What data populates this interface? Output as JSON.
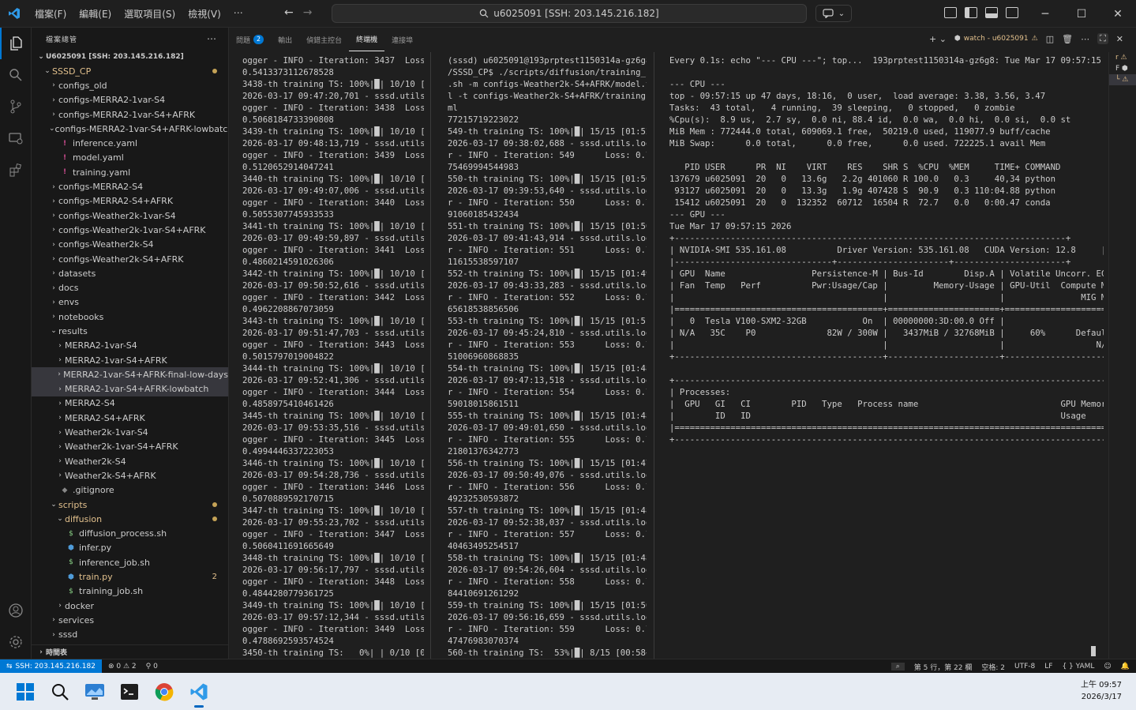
{
  "titlebar": {
    "menu": [
      "檔案(F)",
      "編輯(E)",
      "選取項目(S)",
      "檢視(V)",
      "⋯"
    ],
    "search": "u6025091 [SSH: 203.145.216.182]"
  },
  "sidebar": {
    "title": "檔案總管",
    "more": "⋯",
    "root": "U6025091 [SSH: 203.145.216.182]",
    "items": [
      {
        "label": "SSSD_CP",
        "indent": 1,
        "type": "folder-open",
        "mod": true,
        "dot": true
      },
      {
        "label": "configs_old",
        "indent": 2,
        "type": "folder"
      },
      {
        "label": "configs-MERRA2-1var-S4",
        "indent": 2,
        "type": "folder"
      },
      {
        "label": "configs-MERRA2-1var-S4+AFRK",
        "indent": 2,
        "type": "folder"
      },
      {
        "label": "configs-MERRA2-1var-S4+AFRK-lowbatch",
        "indent": 2,
        "type": "folder-open"
      },
      {
        "label": "inference.yaml",
        "indent": 3,
        "type": "yaml"
      },
      {
        "label": "model.yaml",
        "indent": 3,
        "type": "yaml"
      },
      {
        "label": "training.yaml",
        "indent": 3,
        "type": "yaml"
      },
      {
        "label": "configs-MERRA2-S4",
        "indent": 2,
        "type": "folder"
      },
      {
        "label": "configs-MERRA2-S4+AFRK",
        "indent": 2,
        "type": "folder"
      },
      {
        "label": "configs-Weather2k-1var-S4",
        "indent": 2,
        "type": "folder"
      },
      {
        "label": "configs-Weather2k-1var-S4+AFRK",
        "indent": 2,
        "type": "folder"
      },
      {
        "label": "configs-Weather2k-S4",
        "indent": 2,
        "type": "folder"
      },
      {
        "label": "configs-Weather2k-S4+AFRK",
        "indent": 2,
        "type": "folder"
      },
      {
        "label": "datasets",
        "indent": 2,
        "type": "folder"
      },
      {
        "label": "docs",
        "indent": 2,
        "type": "folder"
      },
      {
        "label": "envs",
        "indent": 2,
        "type": "folder"
      },
      {
        "label": "notebooks",
        "indent": 2,
        "type": "folder"
      },
      {
        "label": "results",
        "indent": 2,
        "type": "folder-open"
      },
      {
        "label": "MERRA2-1var-S4",
        "indent": 3,
        "type": "folder"
      },
      {
        "label": "MERRA2-1var-S4+AFRK",
        "indent": 3,
        "type": "folder"
      },
      {
        "label": "MERRA2-1var-S4+AFRK-final-low-days",
        "indent": 3,
        "type": "folder",
        "sel": true
      },
      {
        "label": "MERRA2-1var-S4+AFRK-lowbatch",
        "indent": 3,
        "type": "folder",
        "sel": true
      },
      {
        "label": "MERRA2-S4",
        "indent": 3,
        "type": "folder"
      },
      {
        "label": "MERRA2-S4+AFRK",
        "indent": 3,
        "type": "folder"
      },
      {
        "label": "Weather2k-1var-S4",
        "indent": 3,
        "type": "folder"
      },
      {
        "label": "Weather2k-1var-S4+AFRK",
        "indent": 3,
        "type": "folder"
      },
      {
        "label": "Weather2k-S4",
        "indent": 3,
        "type": "folder"
      },
      {
        "label": "Weather2k-S4+AFRK",
        "indent": 3,
        "type": "folder"
      },
      {
        "label": ".gitignore",
        "indent": 3,
        "type": "git"
      },
      {
        "label": "scripts",
        "indent": 2,
        "type": "folder-open",
        "mod": true,
        "dot": true
      },
      {
        "label": "diffusion",
        "indent": 3,
        "type": "folder-open",
        "mod": true,
        "dot": true
      },
      {
        "label": "diffusion_process.sh",
        "indent": 4,
        "type": "sh"
      },
      {
        "label": "infer.py",
        "indent": 4,
        "type": "py"
      },
      {
        "label": "inference_job.sh",
        "indent": 4,
        "type": "sh"
      },
      {
        "label": "train.py",
        "indent": 4,
        "type": "py",
        "mod": true,
        "badge": "2"
      },
      {
        "label": "training_job.sh",
        "indent": 4,
        "type": "sh"
      },
      {
        "label": "docker",
        "indent": 3,
        "type": "folder"
      },
      {
        "label": "services",
        "indent": 2,
        "type": "folder"
      },
      {
        "label": "sssd",
        "indent": 2,
        "type": "folder"
      }
    ],
    "footer": "時間表"
  },
  "panel": {
    "tabs": [
      {
        "label": "問題",
        "badge": "2"
      },
      {
        "label": "輸出"
      },
      {
        "label": "偵錯主控台"
      },
      {
        "label": "終端機",
        "active": true
      },
      {
        "label": "連接埠"
      }
    ],
    "watch_label": "watch - u6025091"
  },
  "terminals": {
    "left": "ogger - INFO - Iteration: 3437  Loss:\n0.5413373112678528\n3438-th training TS: 100%|█| 10/10 [00\n2026-03-17 09:47:20,701 - sssd.utils.l\nogger - INFO - Iteration: 3438  Loss:\n0.5068184733390808\n3439-th training TS: 100%|█| 10/10 [00\n2026-03-17 09:48:13,719 - sssd.utils.l\nogger - INFO - Iteration: 3439  Loss:\n0.5120652914047241\n3440-th training TS: 100%|█| 10/10 [00\n2026-03-17 09:49:07,006 - sssd.utils.l\nogger - INFO - Iteration: 3440  Loss:\n0.5055307745933533\n3441-th training TS: 100%|█| 10/10 [00\n2026-03-17 09:49:59,897 - sssd.utils.l\nogger - INFO - Iteration: 3441  Loss:\n0.4860214591026306\n3442-th training TS: 100%|█| 10/10 [00\n2026-03-17 09:50:52,616 - sssd.utils.l\nogger - INFO - Iteration: 3442  Loss:\n0.4962208867073059\n3443-th training TS: 100%|█| 10/10 [00\n2026-03-17 09:51:47,703 - sssd.utils.l\nogger - INFO - Iteration: 3443  Loss:\n0.5015797019004822\n3444-th training TS: 100%|█| 10/10 [00\n2026-03-17 09:52:41,306 - sssd.utils.l\nogger - INFO - Iteration: 3444  Loss:\n0.4858975410461426\n3445-th training TS: 100%|█| 10/10 [00\n2026-03-17 09:53:35,516 - sssd.utils.l\nogger - INFO - Iteration: 3445  Loss:\n0.4994446337223053\n3446-th training TS: 100%|█| 10/10 [00\n2026-03-17 09:54:28,736 - sssd.utils.l\nogger - INFO - Iteration: 3446  Loss:\n0.5070889592170715\n3447-th training TS: 100%|█| 10/10 [00\n2026-03-17 09:55:23,702 - sssd.utils.l\nogger - INFO - Iteration: 3447  Loss:\n0.5060411691665649\n3448-th training TS: 100%|█| 10/10 [00\n2026-03-17 09:56:17,797 - sssd.utils.l\nogger - INFO - Iteration: 3448  Loss:\n0.4844280779361725\n3449-th training TS: 100%|█| 10/10 [00\n2026-03-17 09:57:12,344 - sssd.utils.l\nogger - INFO - Iteration: 3449  Loss:\n0.4788692593574524\n3450-th training TS:   0%| | 0/10 [00",
    "middle": "(sssd) u6025091@193prptest1150314a-gz6g8:~\n/SSSD_CP$ ./scripts/diffusion/training_job\n.sh -m configs-Weather2k-S4+AFRK/model.yam\nl -t configs-Weather2k-S4+AFRK/training.ya\nml\n77215719223022\n549-th training TS: 100%|█| 15/15 [01:52<0\n2026-03-17 09:38:02,688 - sssd.utils.logge\nr - INFO - Iteration: 549      Loss: 0.71\n75469994544983\n550-th training TS: 100%|█| 15/15 [01:50<0\n2026-03-17 09:39:53,640 - sssd.utils.logge\nr - INFO - Iteration: 550      Loss: 0.71\n91060185432434\n551-th training TS: 100%|█| 15/15 [01:50<0\n2026-03-17 09:41:43,914 - sssd.utils.logge\nr - INFO - Iteration: 551      Loss: 0.71\n11615538597107\n552-th training TS: 100%|█| 15/15 [01:49<0\n2026-03-17 09:43:33,283 - sssd.utils.logge\nr - INFO - Iteration: 552      Loss: 0.71\n65618538856506\n553-th training TS: 100%|█| 15/15 [01:51<0\n2026-03-17 09:45:24,810 - sssd.utils.logge\nr - INFO - Iteration: 553      Loss: 0.72\n51006960868835\n554-th training TS: 100%|█| 15/15 [01:48<0\n2026-03-17 09:47:13,518 - sssd.utils.logge\nr - INFO - Iteration: 554      Loss: 0.70\n59018015861511\n555-th training TS: 100%|█| 15/15 [01:48<0\n2026-03-17 09:49:01,650 - sssd.utils.logge\nr - INFO - Iteration: 555      Loss: 0.71\n21801376342773\n556-th training TS: 100%|█| 15/15 [01:47<0\n2026-03-17 09:50:49,076 - sssd.utils.logge\nr - INFO - Iteration: 556      Loss: 0.72\n49232530593872\n557-th training TS: 100%|█| 15/15 [01:48<0\n2026-03-17 09:52:38,037 - sssd.utils.logge\nr - INFO - Iteration: 557      Loss: 0.72\n40463495254517\n558-th training TS: 100%|█| 15/15 [01:48<0\n2026-03-17 09:54:26,604 - sssd.utils.logge\nr - INFO - Iteration: 558      Loss: 0.71\n84410691261292\n559-th training TS: 100%|█| 15/15 [01:50<0\n2026-03-17 09:56:16,659 - sssd.utils.logge\nr - INFO - Iteration: 559      Loss: 0.74\n47476983070374\n560-th training TS:  53%|█| 8/15 [00:58<0",
    "right": "Every 0.1s: echo \"--- CPU ---\"; top...  193prptest1150314a-gz6g8: Tue Mar 17 09:57:15 2026\n\n--- CPU ---\ntop - 09:57:15 up 47 days, 18:16,  0 user,  load average: 3.38, 3.56, 3.47\nTasks:  43 total,   4 running,  39 sleeping,   0 stopped,   0 zombie\n%Cpu(s):  8.9 us,  2.7 sy,  0.0 ni, 88.4 id,  0.0 wa,  0.0 hi,  0.0 si,  0.0 st\nMiB Mem : 772444.0 total, 609069.1 free,  50219.0 used, 119077.9 buff/cache\nMiB Swap:      0.0 total,      0.0 free,      0.0 used. 722225.1 avail Mem\n\n   PID USER      PR  NI    VIRT    RES    SHR S  %CPU  %MEM     TIME+ COMMAND\n137679 u6025091  20   0   13.6g   2.2g 401060 R 100.0   0.3     40,34 python\n 93127 u6025091  20   0   13.3g   1.9g 407428 S  90.9   0.3 110:04.88 python\n 15412 u6025091  20   0  132352  60712  16504 R  72.7   0.0   0:00.47 conda\n--- GPU ---\nTue Mar 17 09:57:15 2026\n+-----------------------------------------------------------------------------+\n| NVIDIA-SMI 535.161.08          Driver Version: 535.161.08   CUDA Version: 12.8     |\n|-------------------------------+----------------------+----------------------+\n| GPU  Name                 Persistence-M | Bus-Id        Disp.A | Volatile Uncorr. ECC |\n| Fan  Temp   Perf          Pwr:Usage/Cap |         Memory-Usage | GPU-Util  Compute M. |\n|                                         |                      |               MIG M. |\n|=========================================+======================+======================|\n|   0  Tesla V100-SXM2-32GB           On  | 00000000:3D:00.0 Off |                    0 |\n| N/A   35C    P0              82W / 300W |   3437MiB / 32768MiB |     60%      Default |\n|                                         |                      |                  N/A |\n+-----------------------------------------+----------------------+----------------------+\n\n+---------------------------------------------------------------------------------------+\n| Processes:                                                                            |\n|  GPU   GI   CI        PID   Type   Process name                            GPU Memory |\n|        ID   ID                                                             Usage      |\n|=======================================================================================|\n+---------------------------------------------------------------------------------------+"
  },
  "statusbar": {
    "remote": "SSH: 203.145.216.182",
    "errors": "0",
    "warnings": "2",
    "ports": "0",
    "position": "第 5 行，第 22 欄",
    "spaces": "空格: 2",
    "encoding": "UTF-8",
    "eol": "LF",
    "language": "YAML"
  },
  "taskbar": {
    "time": "上午 09:57",
    "date": "2026/3/17"
  },
  "colors": {
    "accent": "#0078d4",
    "modified": "#e2c08d"
  }
}
